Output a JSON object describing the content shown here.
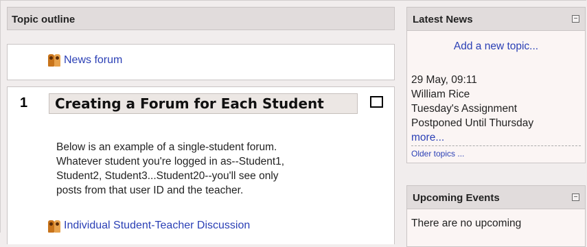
{
  "topic_outline": {
    "title": "Topic outline"
  },
  "news_forum": {
    "icon": "forum-icon",
    "label": "News forum"
  },
  "section1": {
    "number": "1",
    "heading": "Creating a Forum for Each Student",
    "summary_lines": [
      "Below is an example of a single-student forum.",
      "Whatever student you're logged in as--Student1,",
      "Student2, Student3...Student20--you'll see only",
      "posts from that user ID and the teacher."
    ],
    "activity_label": "Individual Student-Teacher Discussion"
  },
  "latest_news": {
    "title": "Latest News",
    "collapse": "−",
    "add_topic": "Add a new topic...",
    "post": {
      "date": "29 May, 09:11",
      "author": "William Rice",
      "subject_lines": [
        "Tuesday's Assignment",
        "Postponed Until Thursday"
      ],
      "more": "more..."
    },
    "older": "Older topics ..."
  },
  "upcoming_events": {
    "title": "Upcoming Events",
    "collapse": "−",
    "text": "There are no upcoming"
  },
  "colors": {
    "link": "#2a3fb5",
    "header_bg": "#e1dcdc",
    "page_bg": "#f1eded"
  }
}
